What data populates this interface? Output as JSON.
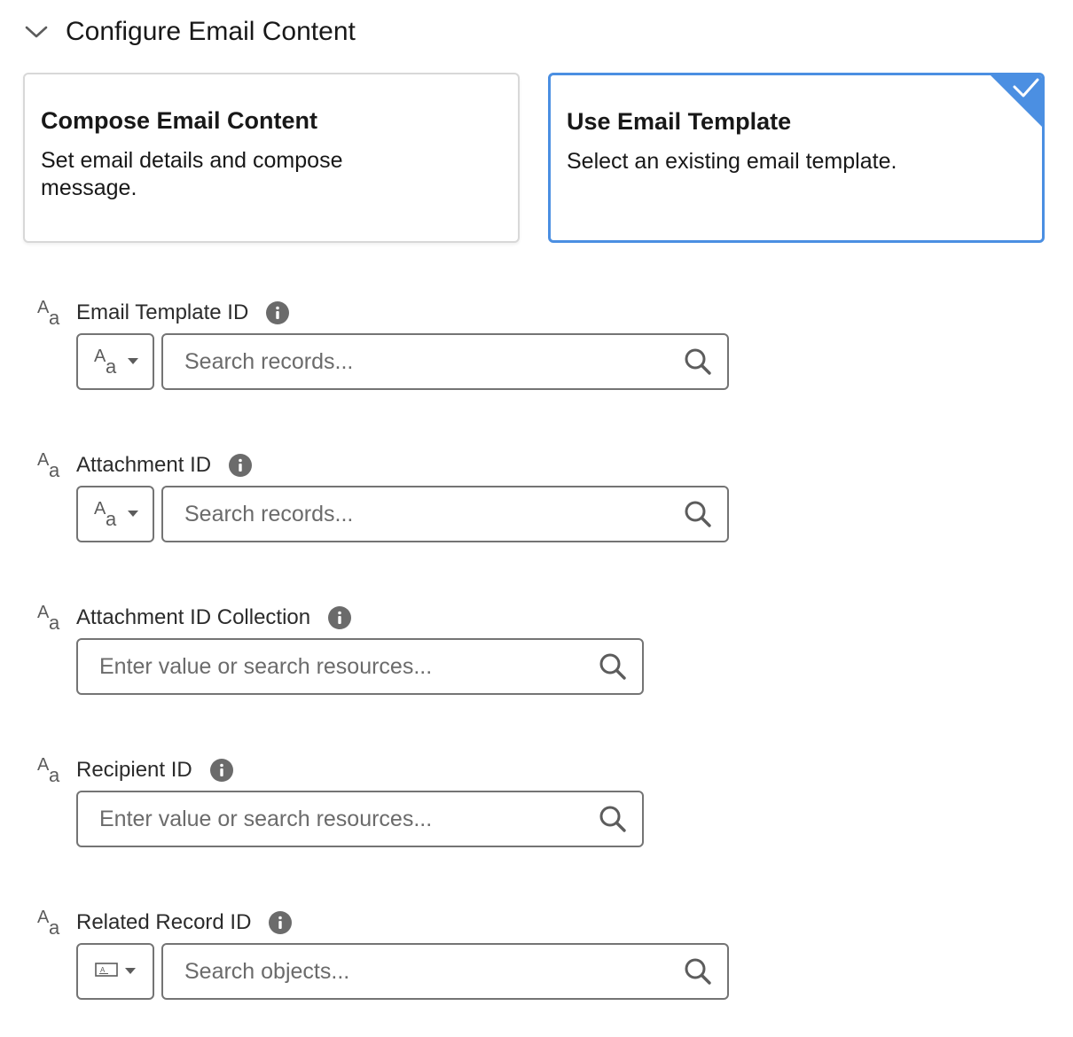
{
  "section": {
    "title": "Configure Email Content",
    "icon": "chevron-down-icon"
  },
  "cards": {
    "compose": {
      "title": "Compose Email Content",
      "description": "Set email details and compose message.",
      "selected": false
    },
    "template": {
      "title": "Use Email Template",
      "description": "Select an existing email template.",
      "selected": true
    }
  },
  "fields": [
    {
      "label": "Email Template ID",
      "placeholder": "Search records...",
      "picker": "text-type",
      "kind": "record"
    },
    {
      "label": "Attachment ID",
      "placeholder": "Search records...",
      "picker": "text-type",
      "kind": "record"
    },
    {
      "label": "Attachment ID Collection",
      "placeholder": "Enter value or search resources...",
      "kind": "resource"
    },
    {
      "label": "Recipient ID",
      "placeholder": "Enter value or search resources...",
      "kind": "resource"
    },
    {
      "label": "Related Record ID",
      "placeholder": "Search objects...",
      "picker": "record-type",
      "kind": "record"
    }
  ],
  "colors": {
    "accent": "#4b8fe2",
    "border": "#747474",
    "info_icon": "#6b6b6b"
  }
}
